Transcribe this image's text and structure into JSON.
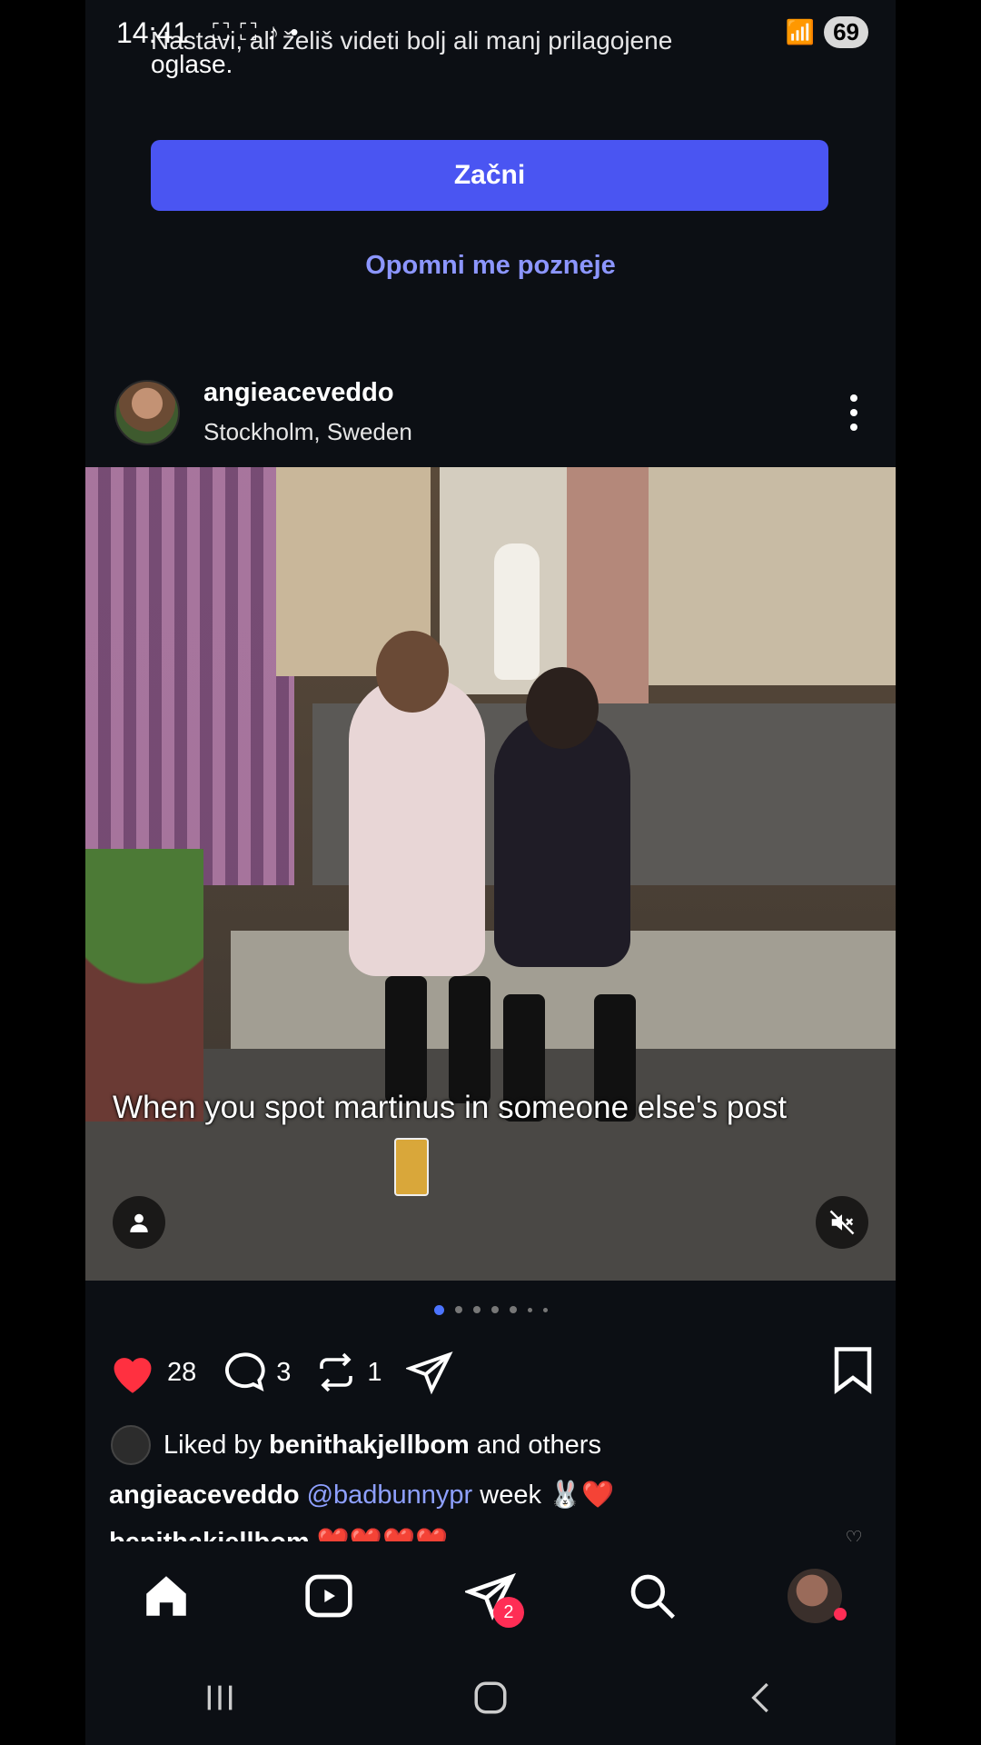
{
  "status_bar": {
    "time": "14:41",
    "battery": "69"
  },
  "ad_prompt": {
    "partial_line": "Nastavi, ali želiš videti bolj ali manj prilagojene",
    "partial_line2": "oglase.",
    "start_label": "Začni",
    "remind_label": "Opomni me pozneje"
  },
  "post": {
    "username": "angieaceveddo",
    "location": "Stockholm, Sweden",
    "overlay_text": "When you spot martinus in someone else's post",
    "likes": "28",
    "comments": "3",
    "reposts": "1",
    "liked_by_prefix": "Liked by ",
    "liked_by_user": "benithakjellbom",
    "liked_by_suffix": " and others",
    "caption_user": "angieaceveddo",
    "caption_mention": "@badbunnypr",
    "caption_text": " week 🐰❤️",
    "comment_peek": "benithakjellbom ❤️❤️❤️❤️"
  },
  "bottom_nav": {
    "messages_badge": "2"
  },
  "colors": {
    "accent": "#4a55f2",
    "link": "#8c96ff",
    "like": "#ff3040"
  }
}
